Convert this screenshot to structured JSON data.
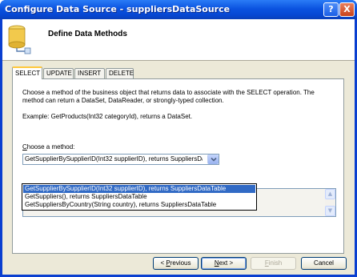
{
  "window": {
    "title": "Configure Data Source - suppliersDataSource",
    "help_glyph": "?",
    "close_glyph": "X"
  },
  "header": {
    "title": "Define Data Methods",
    "icon": "database-icon"
  },
  "tabs": [
    {
      "label": "SELECT",
      "active": true
    },
    {
      "label": "UPDATE",
      "active": false
    },
    {
      "label": "INSERT",
      "active": false
    },
    {
      "label": "DELETE",
      "active": false
    }
  ],
  "select_tab": {
    "description": "Choose a method of the business object that returns data to associate with the SELECT operation. The method can return a DataSet, DataReader, or strongly-typed collection.",
    "example": "Example: GetProducts(Int32 categoryId), returns a DataSet.",
    "choose_label_accel": "C",
    "choose_label_rest": "hoose a method:",
    "method_combo": {
      "selected": "GetSupplierBySupplierID(Int32 supplierID), returns SuppliersDataTable"
    },
    "dropdown_options": [
      {
        "label": "GetSupplierBySupplierID(Int32 supplierID), returns SuppliersDataTable",
        "selected": true
      },
      {
        "label": "GetSuppliers(), returns SuppliersDataTable",
        "selected": false
      },
      {
        "label": "GetSuppliersByCountry(String country), returns SuppliersDataTable",
        "selected": false
      }
    ]
  },
  "footer": {
    "previous": {
      "lead": "< ",
      "accel": "P",
      "rest": "revious"
    },
    "next": {
      "accel": "N",
      "rest": "ext >"
    },
    "finish": {
      "accel": "F",
      "rest": "inish"
    },
    "cancel": "Cancel"
  },
  "colors": {
    "titlebar": "#0b53e0",
    "selection": "#316ac5",
    "tab_highlight": "#ffc83c"
  }
}
